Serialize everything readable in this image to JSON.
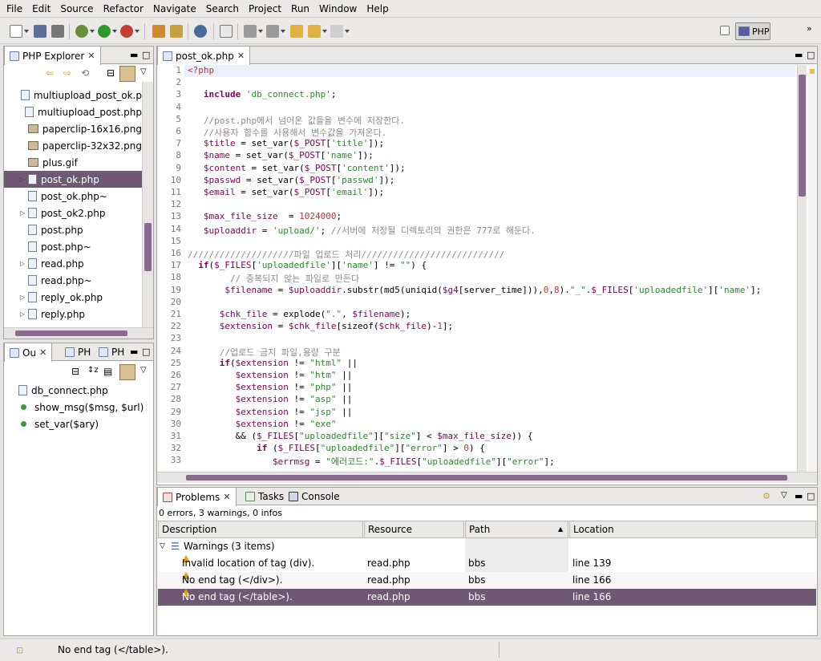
{
  "menu": [
    "File",
    "Edit",
    "Source",
    "Refactor",
    "Navigate",
    "Search",
    "Project",
    "Run",
    "Window",
    "Help"
  ],
  "perspective": {
    "label": "PHP"
  },
  "explorer": {
    "title": "PHP Explorer",
    "items": [
      {
        "label": "multiupload_post_ok.p",
        "type": "php",
        "expandable": false
      },
      {
        "label": "multiupload_post.php",
        "type": "php",
        "expandable": false
      },
      {
        "label": "paperclip-16x16.png",
        "type": "image",
        "expandable": false
      },
      {
        "label": "paperclip-32x32.png",
        "type": "image",
        "expandable": false
      },
      {
        "label": "plus.gif",
        "type": "image",
        "expandable": false
      },
      {
        "label": "post_ok.php",
        "type": "php",
        "expandable": true
      },
      {
        "label": "post_ok.php~",
        "type": "file",
        "expandable": false
      },
      {
        "label": "post_ok2.php",
        "type": "php",
        "expandable": true
      },
      {
        "label": "post.php",
        "type": "php",
        "expandable": false
      },
      {
        "label": "post.php~",
        "type": "file",
        "expandable": false
      },
      {
        "label": "read.php",
        "type": "php",
        "expandable": true
      },
      {
        "label": "read.php~",
        "type": "file",
        "expandable": false
      },
      {
        "label": "reply_ok.php",
        "type": "php",
        "expandable": true
      },
      {
        "label": "reply.php",
        "type": "php",
        "expandable": true
      }
    ]
  },
  "outline": {
    "tabs": [
      "Ou",
      "PH",
      "PH"
    ],
    "items": [
      "db_connect.php",
      "show_msg($msg,  $url)",
      "set_var($ary)"
    ]
  },
  "editor": {
    "tab": "post_ok.php",
    "lines": [
      "<?php",
      "",
      "   include 'db_connect.php';",
      "",
      "   //post.php에서 넘어온 값들을 변수에 저장한다.",
      "   //사용자 함수를 사용해서 변수값을 가져온다.",
      "   $title = set_var($_POST['title']);",
      "   $name = set_var($_POST['name']);",
      "   $content = set_var($_POST['content']);",
      "   $passwd = set_var($_POST['passwd']);",
      "   $email = set_var($_POST['email']);",
      "",
      "   $max_file_size  = 1024000;",
      "   $uploaddir = 'upload/'; //서버에 저장될 디렉토리의 권한은 777로 해둔다.",
      "",
      "////////////////////파일 업로드 처리///////////////////////////",
      "  if($_FILES['uploadedfile']['name'] != \"\") {",
      "        // 중복되지 않는 파일로 만든다",
      "       $filename = $uploaddir.substr(md5(uniqid($g4[server_time])),0,8).\"_\".$_FILES['uploadedfile']['name'];",
      "",
      "      $chk_file = explode(\".\", $filename);",
      "      $extension = $chk_file[sizeof($chk_file)-1];",
      "",
      "      //업로드 금지 파일,용량 구분",
      "      if($extension != \"html\" ||",
      "         $extension != \"htm\" ||",
      "         $extension != \"php\" ||",
      "         $extension != \"asp\" ||",
      "         $extension != \"jsp\" ||",
      "         $extension != \"exe\"",
      "         && ($_FILES[\"uploadedfile\"][\"size\"] < $max_file_size)) {",
      "             if ($_FILES[\"uploadedfile\"][\"error\"] > 0) {",
      "                $errmsg = \"에러코드:\".$_FILES[\"uploadedfile\"][\"error\"];"
    ]
  },
  "problems": {
    "tabs": [
      "Problems",
      "Tasks",
      "Console"
    ],
    "summary": "0 errors, 3 warnings, 0 infos",
    "columns": [
      "Description",
      "Resource",
      "Path",
      "Location"
    ],
    "group": "Warnings (3 items)",
    "rows": [
      {
        "description": "Invalid location of tag (div).",
        "resource": "read.php",
        "path": "bbs",
        "location": "line 139"
      },
      {
        "description": "No end tag (</div>).",
        "resource": "read.php",
        "path": "bbs",
        "location": "line 166"
      },
      {
        "description": "No end tag (</table>).",
        "resource": "read.php",
        "path": "bbs",
        "location": "line 166"
      }
    ]
  },
  "status": {
    "message": "No end tag (</table>)."
  },
  "colors": {
    "selection": "#6f5874",
    "keyword": "#7f0055",
    "string": "#2a8a2a",
    "variable": "#7f0055",
    "comment": "#8a8a8a"
  }
}
